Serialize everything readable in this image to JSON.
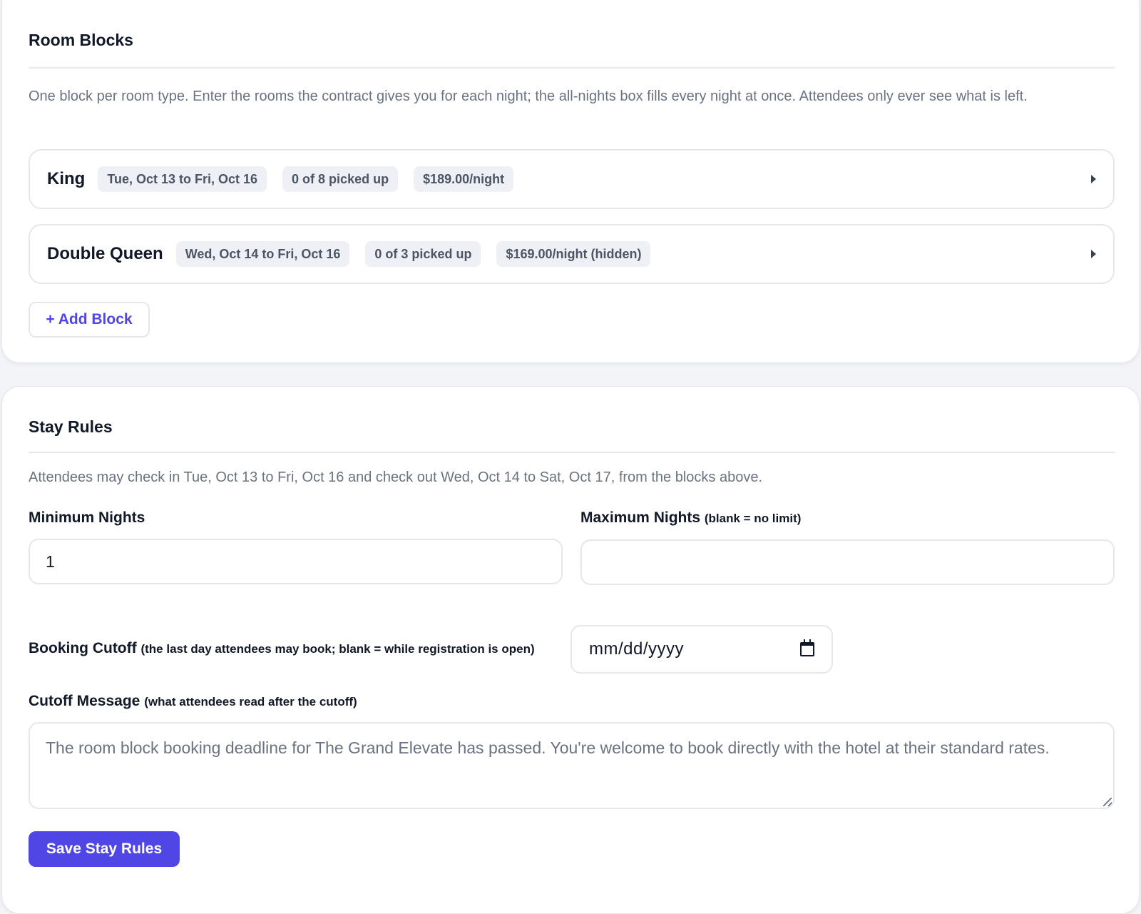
{
  "room_blocks": {
    "title": "Room Blocks",
    "description": "One block per room type. Enter the rooms the contract gives you for each night; the all-nights box fills every night at once. Attendees only ever see what is left.",
    "blocks": [
      {
        "name": "King",
        "dates": "Tue, Oct 13 to Fri, Oct 16",
        "pickup": "0 of 8 picked up",
        "rate": "$189.00/night"
      },
      {
        "name": "Double Queen",
        "dates": "Wed, Oct 14 to Fri, Oct 16",
        "pickup": "0 of 3 picked up",
        "rate": "$169.00/night (hidden)"
      }
    ],
    "add_label": "+ Add Block"
  },
  "stay_rules": {
    "title": "Stay Rules",
    "description": "Attendees may check in Tue, Oct 13 to Fri, Oct 16 and check out Wed, Oct 14 to Sat, Oct 17, from the blocks above.",
    "min_nights": {
      "label": "Minimum Nights",
      "value": "1"
    },
    "max_nights": {
      "label": "Maximum Nights",
      "hint": "(blank = no limit)",
      "value": ""
    },
    "booking_cutoff": {
      "label": "Booking Cutoff",
      "hint": "(the last day attendees may book; blank = while registration is open)",
      "placeholder": "mm/dd/yyyy"
    },
    "cutoff_message": {
      "label": "Cutoff Message",
      "hint": "(what attendees read after the cutoff)",
      "placeholder": "The room block booking deadline for The Grand Elevate has passed. You're welcome to book directly with the hotel at their standard rates."
    },
    "save_label": "Save Stay Rules"
  },
  "colors": {
    "accent": "#4f46e5",
    "chip_bg": "#eef0f5",
    "muted_text": "#6b7280",
    "border": "#e5e7eb"
  }
}
